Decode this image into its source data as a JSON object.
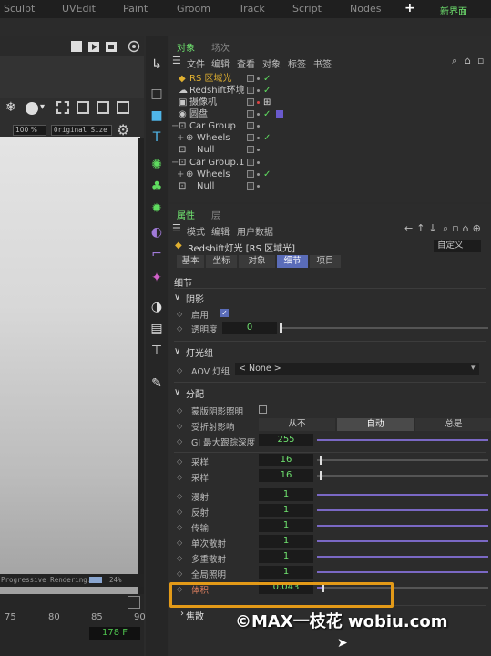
{
  "topbar": {
    "tabs": [
      "Sculpt",
      "UVEdit",
      "Paint",
      "Groom",
      "Track",
      "Script",
      "Nodes"
    ],
    "plus": "+",
    "new_layout": "新界面"
  },
  "viewport": {
    "zoom": "100 %",
    "size": "Original Size",
    "progress_text": "Progressive Rendering...",
    "progress_percent": "24%",
    "timeline_ticks": [
      "75",
      "80",
      "85",
      "90"
    ],
    "frame": "178 F"
  },
  "object_panel": {
    "tabs": [
      "对象",
      "场次"
    ],
    "menu": [
      "文件",
      "编辑",
      "查看",
      "对象",
      "标签",
      "书签"
    ],
    "rows": [
      {
        "name": "RS 区域光",
        "color": "#e0b030"
      },
      {
        "name": "Redshift环境",
        "color": "#c8c8c8"
      },
      {
        "name": "摄像机",
        "color": "#c8c8c8"
      },
      {
        "name": "圆盘",
        "color": "#c8c8c8"
      },
      {
        "name": "Car Group",
        "color": "#c8c8c8"
      },
      {
        "name": "Wheels",
        "color": "#c8c8c8"
      },
      {
        "name": "Null",
        "color": "#c8c8c8"
      },
      {
        "name": "Car Group.1",
        "color": "#c8c8c8"
      },
      {
        "name": "Wheels",
        "color": "#c8c8c8"
      },
      {
        "name": "Null",
        "color": "#c8c8c8"
      }
    ]
  },
  "attr_panel": {
    "tabs": [
      "属性",
      "层"
    ],
    "menu": [
      "模式",
      "编辑",
      "用户数据"
    ],
    "object_title": "Redshift灯光 [RS 区域光]",
    "preset": "自定义",
    "subtabs": [
      "基本",
      "坐标",
      "对象",
      "细节",
      "项目"
    ],
    "detail_title": "细节",
    "shadow": {
      "title": "阴影",
      "enable_label": "启用",
      "transparency_label": "透明度",
      "transparency_value": "0"
    },
    "light_group": {
      "title": "灯光组",
      "aov_label": "AOV 灯组",
      "aov_value": "< None >"
    },
    "contribution": {
      "title": "分配",
      "shadow_catch_label": "蒙版阴影照明",
      "refraction_label": "受折射影响",
      "refraction_options": [
        "从不",
        "自动",
        "总是"
      ],
      "gi_depth_label": "GI 最大跟踪深度",
      "gi_depth_value": "255",
      "samples": [
        {
          "label": "采样",
          "value": "16"
        },
        {
          "label": "采样",
          "value": "16"
        }
      ],
      "multipliers": [
        {
          "label": "漫射",
          "value": "1"
        },
        {
          "label": "反射",
          "value": "1"
        },
        {
          "label": "传输",
          "value": "1"
        },
        {
          "label": "单次散射",
          "value": "1"
        },
        {
          "label": "多重散射",
          "value": "1"
        },
        {
          "label": "全局照明",
          "value": "1"
        }
      ],
      "volume_label": "体积",
      "volume_value": "0.043"
    },
    "caustics_title": "焦散"
  },
  "watermark": "©MAX一枝花  wobiu.com",
  "colors": {
    "accent_green": "#6fe36f",
    "slider_purple": "#7a68c4",
    "highlight_orange": "#e39a18",
    "volume_red": "#e08060"
  }
}
